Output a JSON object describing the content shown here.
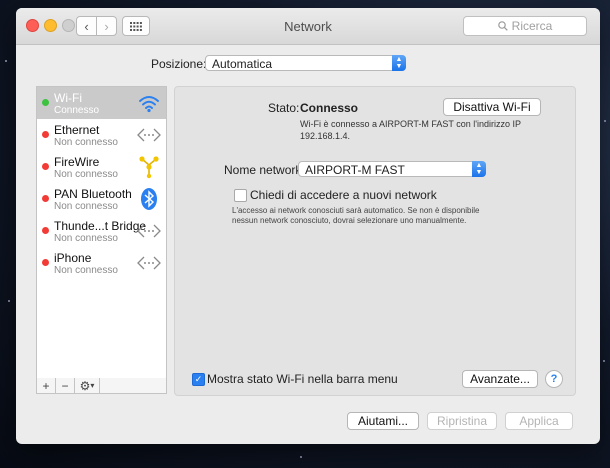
{
  "window": {
    "title": "Network",
    "search_placeholder": "Ricerca"
  },
  "location": {
    "label": "Posizione:",
    "value": "Automatica"
  },
  "services": [
    {
      "name": "Wi-Fi",
      "status": "Connesso",
      "dot": "#3cc23f",
      "icon": "wifi-icon",
      "selected": true
    },
    {
      "name": "Ethernet",
      "status": "Non connesso",
      "dot": "#f33b36",
      "icon": "ethernet-icon"
    },
    {
      "name": "FireWire",
      "status": "Non connesso",
      "dot": "#f33b36",
      "icon": "firewire-icon"
    },
    {
      "name": "PAN Bluetooth",
      "status": "Non connesso",
      "dot": "#f33b36",
      "icon": "bluetooth-icon"
    },
    {
      "name": "Thunde...t Bridge",
      "status": "Non connesso",
      "dot": "#f33b36",
      "icon": "thunderbolt-bridge-icon"
    },
    {
      "name": "iPhone",
      "status": "Non connesso",
      "dot": "#f33b36",
      "icon": "iphone-connection-icon"
    }
  ],
  "sidebar_toolbar": {
    "add": "+",
    "remove": "−"
  },
  "detail": {
    "status_label": "Stato:",
    "status_value": "Connesso",
    "toggle_button": "Disattiva Wi-Fi",
    "status_desc_line1": "Wi-Fi è connesso a AIRPORT-M FAST con l'indirizzo IP",
    "status_desc_line2": "192.168.1.4.",
    "network_label": "Nome network:",
    "network_value": "AIRPORT-M FAST",
    "ask_label": "Chiedi di accedere a nuovi network",
    "ask_desc_line1": "L'accesso ai network conosciuti sarà automatico. Se non è disponibile",
    "ask_desc_line2": "nessun network conosciuto, dovrai selezionare uno manualmente.",
    "show_status_label": "Mostra stato Wi-Fi nella barra menu",
    "advanced_button": "Avanzate...",
    "help": "?"
  },
  "footer": {
    "assist": "Aiutami...",
    "revert": "Ripristina",
    "apply": "Applica"
  },
  "colors": {
    "accent": "#2a80f0",
    "connected": "#3cc23f",
    "disconnected": "#f33b36"
  }
}
